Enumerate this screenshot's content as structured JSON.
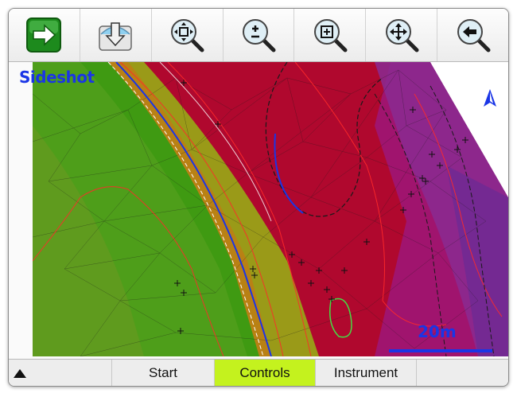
{
  "toolbar": {
    "buttons": [
      {
        "icon": "arrow-right-icon"
      },
      {
        "icon": "download-arrow-icon"
      },
      {
        "icon": "zoom-fit-icon"
      },
      {
        "icon": "zoom-in-out-icon"
      },
      {
        "icon": "zoom-window-icon"
      },
      {
        "icon": "pan-icon"
      },
      {
        "icon": "back-icon"
      }
    ]
  },
  "map": {
    "mode_label": "Sideshot",
    "scale_label": "20m",
    "colors": {
      "accent_blue": "#1a35e6",
      "green": "#3f9a12",
      "olive": "#9a9a18",
      "red": "#b0082e",
      "magenta": "#a0146e",
      "purple": "#7a2a8e"
    }
  },
  "statusbar": {
    "start_label": "Start",
    "controls_label": "Controls",
    "instrument_label": "Instrument",
    "active_tab": "Controls"
  }
}
